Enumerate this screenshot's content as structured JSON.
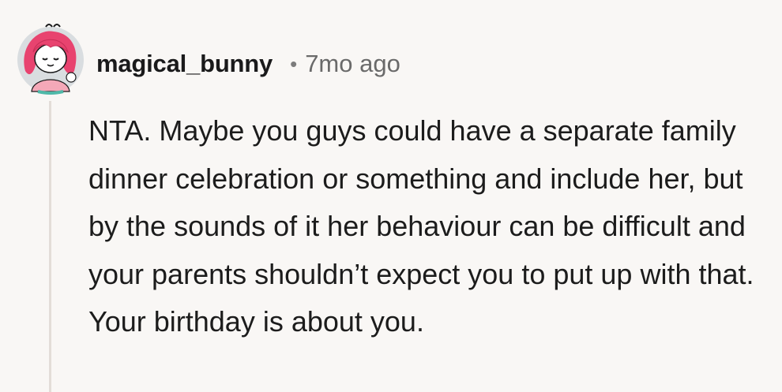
{
  "comment": {
    "author": "magical_bunny",
    "separator": "•",
    "timestamp": "7mo ago",
    "body": "NTA. Maybe you guys could have a separate family dinner celebration or something and include her, but by the sounds of it her behaviour can be difficult and your parents shouldn’t expect you to put up with that. Your birthday is about you."
  },
  "avatar": {
    "icon": "pink-haired-character-avatar",
    "hair_color": "#e8436f",
    "background_color": "#d9dde0"
  },
  "colors": {
    "background": "#f9f7f5",
    "text": "#1c1c1c",
    "muted": "#6a6a6a",
    "thread_line": "#e3ddd8"
  }
}
